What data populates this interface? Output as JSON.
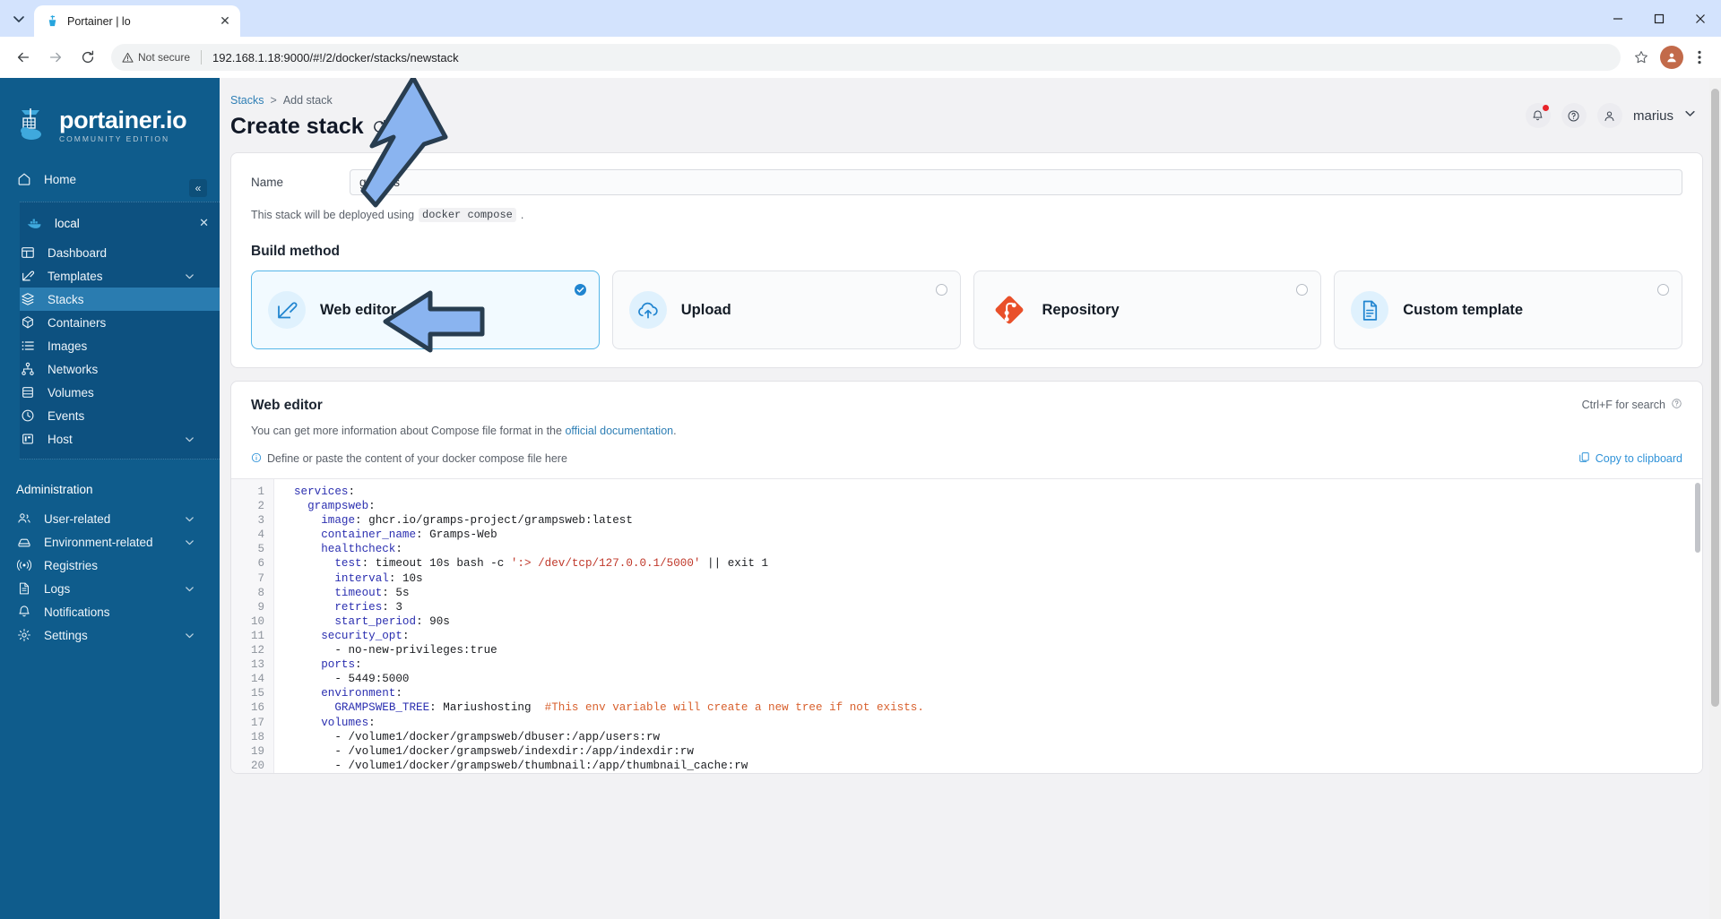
{
  "browser": {
    "tab_title": "Portainer | lo",
    "url": "192.168.1.18:9000/#!/2/docker/stacks/newstack",
    "security_label": "Not secure"
  },
  "sidebar": {
    "logo_main": "portainer.io",
    "logo_sub": "COMMUNITY EDITION",
    "home_label": "Home",
    "environment": {
      "name": "local",
      "items": [
        {
          "label": "Dashboard",
          "icon": "dashboard-icon",
          "chevron": false,
          "active": false
        },
        {
          "label": "Templates",
          "icon": "templates-icon",
          "chevron": true,
          "active": false
        },
        {
          "label": "Stacks",
          "icon": "stacks-icon",
          "chevron": false,
          "active": true
        },
        {
          "label": "Containers",
          "icon": "containers-icon",
          "chevron": false,
          "active": false
        },
        {
          "label": "Images",
          "icon": "images-icon",
          "chevron": false,
          "active": false
        },
        {
          "label": "Networks",
          "icon": "networks-icon",
          "chevron": false,
          "active": false
        },
        {
          "label": "Volumes",
          "icon": "volumes-icon",
          "chevron": false,
          "active": false
        },
        {
          "label": "Events",
          "icon": "events-icon",
          "chevron": false,
          "active": false
        },
        {
          "label": "Host",
          "icon": "host-icon",
          "chevron": true,
          "active": false
        }
      ]
    },
    "admin_label": "Administration",
    "admin_items": [
      {
        "label": "User-related",
        "icon": "users-icon",
        "chevron": true
      },
      {
        "label": "Environment-related",
        "icon": "environment-icon",
        "chevron": true
      },
      {
        "label": "Registries",
        "icon": "registries-icon",
        "chevron": false
      },
      {
        "label": "Logs",
        "icon": "logs-icon",
        "chevron": true
      },
      {
        "label": "Notifications",
        "icon": "notifications-icon",
        "chevron": false
      },
      {
        "label": "Settings",
        "icon": "settings-icon",
        "chevron": true
      }
    ]
  },
  "header": {
    "breadcrumb_root": "Stacks",
    "breadcrumb_sep": ">",
    "breadcrumb_current": "Add stack",
    "title": "Create stack",
    "user": "marius"
  },
  "form": {
    "name_label": "Name",
    "name_value": "gramps",
    "deploy_hint_pre": "This stack will be deployed using",
    "deploy_hint_code": "docker compose",
    "deploy_hint_post": "."
  },
  "build_method": {
    "title": "Build method",
    "options": [
      {
        "label": "Web editor",
        "icon": "web-editor-icon",
        "selected": true
      },
      {
        "label": "Upload",
        "icon": "upload-cloud-icon",
        "selected": false
      },
      {
        "label": "Repository",
        "icon": "git-repository-icon",
        "selected": false
      },
      {
        "label": "Custom template",
        "icon": "custom-template-icon",
        "selected": false
      }
    ]
  },
  "web_editor": {
    "title": "Web editor",
    "search_hint": "Ctrl+F for search",
    "description_pre": "You can get more information about Compose file format in the ",
    "description_link": "official documentation",
    "description_post": ".",
    "define_hint": "Define or paste the content of your docker compose file here",
    "copy_label": "Copy to clipboard",
    "lines": [
      {
        "n": 1,
        "segments": [
          {
            "t": "services",
            "c": "k"
          },
          {
            "t": ":",
            "c": "v"
          }
        ]
      },
      {
        "n": 2,
        "segments": [
          {
            "t": "  ",
            "c": "v"
          },
          {
            "t": "grampsweb",
            "c": "k"
          },
          {
            "t": ":",
            "c": "v"
          }
        ]
      },
      {
        "n": 3,
        "segments": [
          {
            "t": "    ",
            "c": "v"
          },
          {
            "t": "image",
            "c": "k"
          },
          {
            "t": ": ghcr.io/gramps-project/grampsweb:latest",
            "c": "v"
          }
        ]
      },
      {
        "n": 4,
        "segments": [
          {
            "t": "    ",
            "c": "v"
          },
          {
            "t": "container_name",
            "c": "k"
          },
          {
            "t": ": Gramps-Web",
            "c": "v"
          }
        ]
      },
      {
        "n": 5,
        "segments": [
          {
            "t": "    ",
            "c": "v"
          },
          {
            "t": "healthcheck",
            "c": "k"
          },
          {
            "t": ":",
            "c": "v"
          }
        ]
      },
      {
        "n": 6,
        "segments": [
          {
            "t": "      ",
            "c": "v"
          },
          {
            "t": "test",
            "c": "k"
          },
          {
            "t": ": timeout 10s bash -c ",
            "c": "v"
          },
          {
            "t": "':> /dev/tcp/127.0.0.1/5000'",
            "c": "s"
          },
          {
            "t": " || exit 1",
            "c": "v"
          }
        ]
      },
      {
        "n": 7,
        "segments": [
          {
            "t": "      ",
            "c": "v"
          },
          {
            "t": "interval",
            "c": "k"
          },
          {
            "t": ": 10s",
            "c": "v"
          }
        ]
      },
      {
        "n": 8,
        "segments": [
          {
            "t": "      ",
            "c": "v"
          },
          {
            "t": "timeout",
            "c": "k"
          },
          {
            "t": ": 5s",
            "c": "v"
          }
        ]
      },
      {
        "n": 9,
        "segments": [
          {
            "t": "      ",
            "c": "v"
          },
          {
            "t": "retries",
            "c": "k"
          },
          {
            "t": ": 3",
            "c": "v"
          }
        ]
      },
      {
        "n": 10,
        "segments": [
          {
            "t": "      ",
            "c": "v"
          },
          {
            "t": "start_period",
            "c": "k"
          },
          {
            "t": ": 90s",
            "c": "v"
          }
        ]
      },
      {
        "n": 11,
        "segments": [
          {
            "t": "    ",
            "c": "v"
          },
          {
            "t": "security_opt",
            "c": "k"
          },
          {
            "t": ":",
            "c": "v"
          }
        ]
      },
      {
        "n": 12,
        "segments": [
          {
            "t": "      - no-new-privileges:true",
            "c": "v"
          }
        ]
      },
      {
        "n": 13,
        "segments": [
          {
            "t": "    ",
            "c": "v"
          },
          {
            "t": "ports",
            "c": "k"
          },
          {
            "t": ":",
            "c": "v"
          }
        ]
      },
      {
        "n": 14,
        "segments": [
          {
            "t": "      - 5449:5000",
            "c": "v"
          }
        ]
      },
      {
        "n": 15,
        "segments": [
          {
            "t": "    ",
            "c": "v"
          },
          {
            "t": "environment",
            "c": "k"
          },
          {
            "t": ":",
            "c": "v"
          }
        ]
      },
      {
        "n": 16,
        "segments": [
          {
            "t": "      ",
            "c": "v"
          },
          {
            "t": "GRAMPSWEB_TREE",
            "c": "k"
          },
          {
            "t": ": Mariushosting  ",
            "c": "v"
          },
          {
            "t": "#This env variable will create a new tree if not exists.",
            "c": "cm"
          }
        ]
      },
      {
        "n": 17,
        "segments": [
          {
            "t": "    ",
            "c": "v"
          },
          {
            "t": "volumes",
            "c": "k"
          },
          {
            "t": ":",
            "c": "v"
          }
        ]
      },
      {
        "n": 18,
        "segments": [
          {
            "t": "      - /volume1/docker/grampsweb/dbuser:/app/users:rw",
            "c": "v"
          }
        ]
      },
      {
        "n": 19,
        "segments": [
          {
            "t": "      - /volume1/docker/grampsweb/indexdir:/app/indexdir:rw",
            "c": "v"
          }
        ]
      },
      {
        "n": 20,
        "segments": [
          {
            "t": "      - /volume1/docker/grampsweb/thumbnail:/app/thumbnail_cache:rw",
            "c": "v"
          }
        ]
      }
    ]
  },
  "colors": {
    "sidebar_bg": "#0f5c8c",
    "sidebar_active": "#2a7cb0",
    "accent_blue": "#2f92d8",
    "annotation_arrow_fill": "#8ab4f0",
    "annotation_arrow_stroke": "#283d50"
  }
}
